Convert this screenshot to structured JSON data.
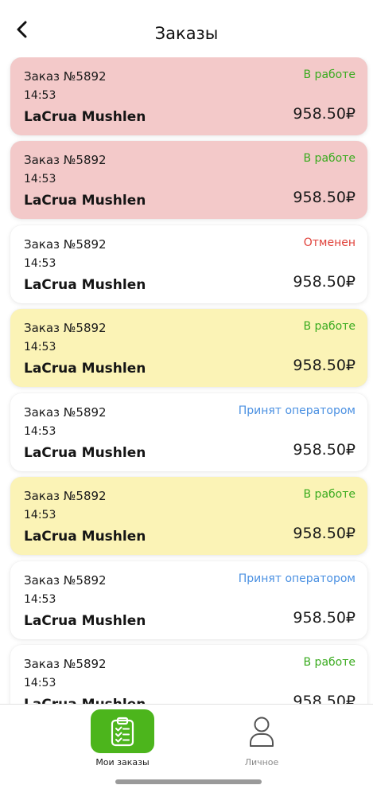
{
  "header": {
    "title": "Заказы"
  },
  "orders": [
    {
      "number": "Заказ №5892",
      "time": "14:53",
      "customer": "LaCrua Mushlen",
      "status": "В работе",
      "price": "958.50₽",
      "bg": "#f3c9c9",
      "status_color": "#3aab1f"
    },
    {
      "number": "Заказ №5892",
      "time": "14:53",
      "customer": "LaCrua Mushlen",
      "status": "В работе",
      "price": "958.50₽",
      "bg": "#f3c9c9",
      "status_color": "#3aab1f"
    },
    {
      "number": "Заказ №5892",
      "time": "14:53",
      "customer": "LaCrua Mushlen",
      "status": "Отменен",
      "price": "958.50₽",
      "bg": "#ffffff",
      "status_color": "#e0413a"
    },
    {
      "number": "Заказ №5892",
      "time": "14:53",
      "customer": "LaCrua Mushlen",
      "status": "В работе",
      "price": "958.50₽",
      "bg": "#fbf3b6",
      "status_color": "#3aab1f"
    },
    {
      "number": "Заказ №5892",
      "time": "14:53",
      "customer": "LaCrua Mushlen",
      "status": "Принят оператором",
      "price": "958.50₽",
      "bg": "#ffffff",
      "status_color": "#4a90e2"
    },
    {
      "number": "Заказ №5892",
      "time": "14:53",
      "customer": "LaCrua Mushlen",
      "status": "В работе",
      "price": "958.50₽",
      "bg": "#fbf3b6",
      "status_color": "#3aab1f"
    },
    {
      "number": "Заказ №5892",
      "time": "14:53",
      "customer": "LaCrua Mushlen",
      "status": "Принят оператором",
      "price": "958.50₽",
      "bg": "#ffffff",
      "status_color": "#4a90e2"
    },
    {
      "number": "Заказ №5892",
      "time": "14:53",
      "customer": "LaCrua Mushlen",
      "status": "В работе",
      "price": "958.50₽",
      "bg": "#ffffff",
      "status_color": "#3aab1f"
    }
  ],
  "tabbar": {
    "tabs": [
      {
        "label": "Мои заказы",
        "icon": "clipboard-list-icon",
        "active": true,
        "active_bg": "#4cb51c",
        "label_color": "#1a1a1a"
      },
      {
        "label": "Личное",
        "icon": "user-icon",
        "active": false,
        "label_color": "#8a8a8a"
      }
    ]
  }
}
